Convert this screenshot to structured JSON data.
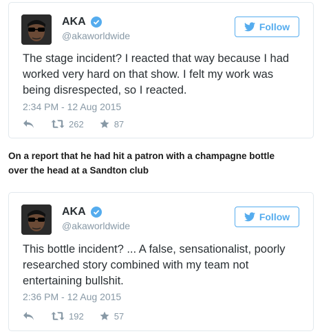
{
  "caption": {
    "line1": "On a report that he had hit a patron with a champagne bottle",
    "line2": "over the head at a Sandton club"
  },
  "tweets": [
    {
      "author": "AKA",
      "handle": "@akaworldwide",
      "follow_label": "Follow",
      "lines": [
        "The stage incident? I reacted that way because I had",
        "worked very hard on that show. I felt my work was",
        "being disrespected, so I reacted."
      ],
      "timestamp": "2:34 PM - 12 Aug 2015",
      "retweets": "262",
      "likes": "87"
    },
    {
      "author": "AKA",
      "handle": "@akaworldwide",
      "follow_label": "Follow",
      "lines": [
        "This bottle incident? ... A false, sensationalist, poorly",
        "researched story combined with my team not",
        "entertaining bullshit."
      ],
      "timestamp": "2:36 PM - 12 Aug 2015",
      "retweets": "192",
      "likes": "57"
    }
  ],
  "colors": {
    "twitter_blue": "#55acee",
    "muted": "#8899a6",
    "text": "#292f33",
    "border": "#e1e8ed"
  },
  "icons": [
    "avatar",
    "verified-badge-icon",
    "twitter-bird-icon",
    "reply-icon",
    "retweet-icon",
    "star-icon"
  ]
}
